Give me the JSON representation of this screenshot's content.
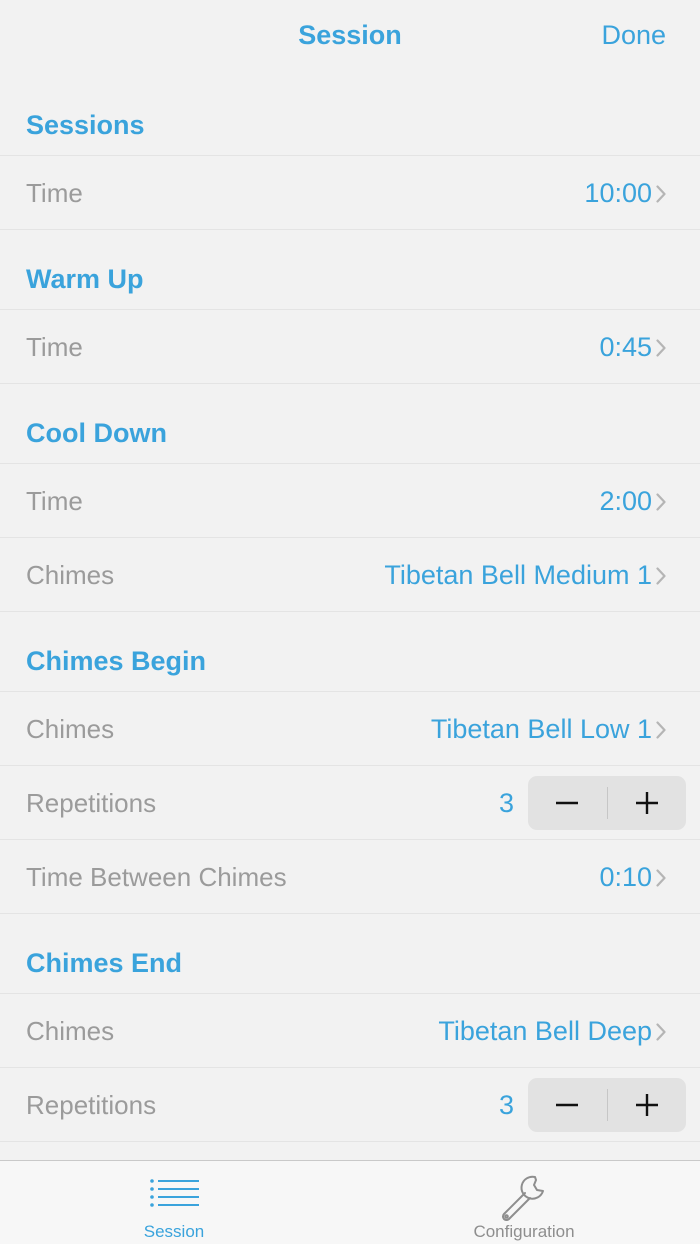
{
  "navbar": {
    "title": "Session",
    "done_label": "Done"
  },
  "sections": {
    "sessions": {
      "header": "Sessions",
      "time_label": "Time",
      "time_value": "10:00"
    },
    "warm_up": {
      "header": "Warm Up",
      "time_label": "Time",
      "time_value": "0:45"
    },
    "cool_down": {
      "header": "Cool Down",
      "time_label": "Time",
      "time_value": "2:00",
      "chimes_label": "Chimes",
      "chimes_value": "Tibetan Bell Medium 1"
    },
    "chimes_begin": {
      "header": "Chimes Begin",
      "chimes_label": "Chimes",
      "chimes_value": "Tibetan Bell Low 1",
      "repetitions_label": "Repetitions",
      "repetitions_value": "3",
      "time_between_label": "Time Between Chimes",
      "time_between_value": "0:10"
    },
    "chimes_end": {
      "header": "Chimes End",
      "chimes_label": "Chimes",
      "chimes_value": "Tibetan Bell Deep",
      "repetitions_label": "Repetitions",
      "repetitions_value": "3"
    }
  },
  "tabbar": {
    "tabs": [
      {
        "label": "Session",
        "icon": "list-icon",
        "active": true
      },
      {
        "label": "Configuration",
        "icon": "wrench-icon",
        "active": false
      }
    ]
  },
  "colors": {
    "accent": "#3aa3dc",
    "label_gray": "#9b9b9b",
    "background": "#f2f2f2"
  }
}
